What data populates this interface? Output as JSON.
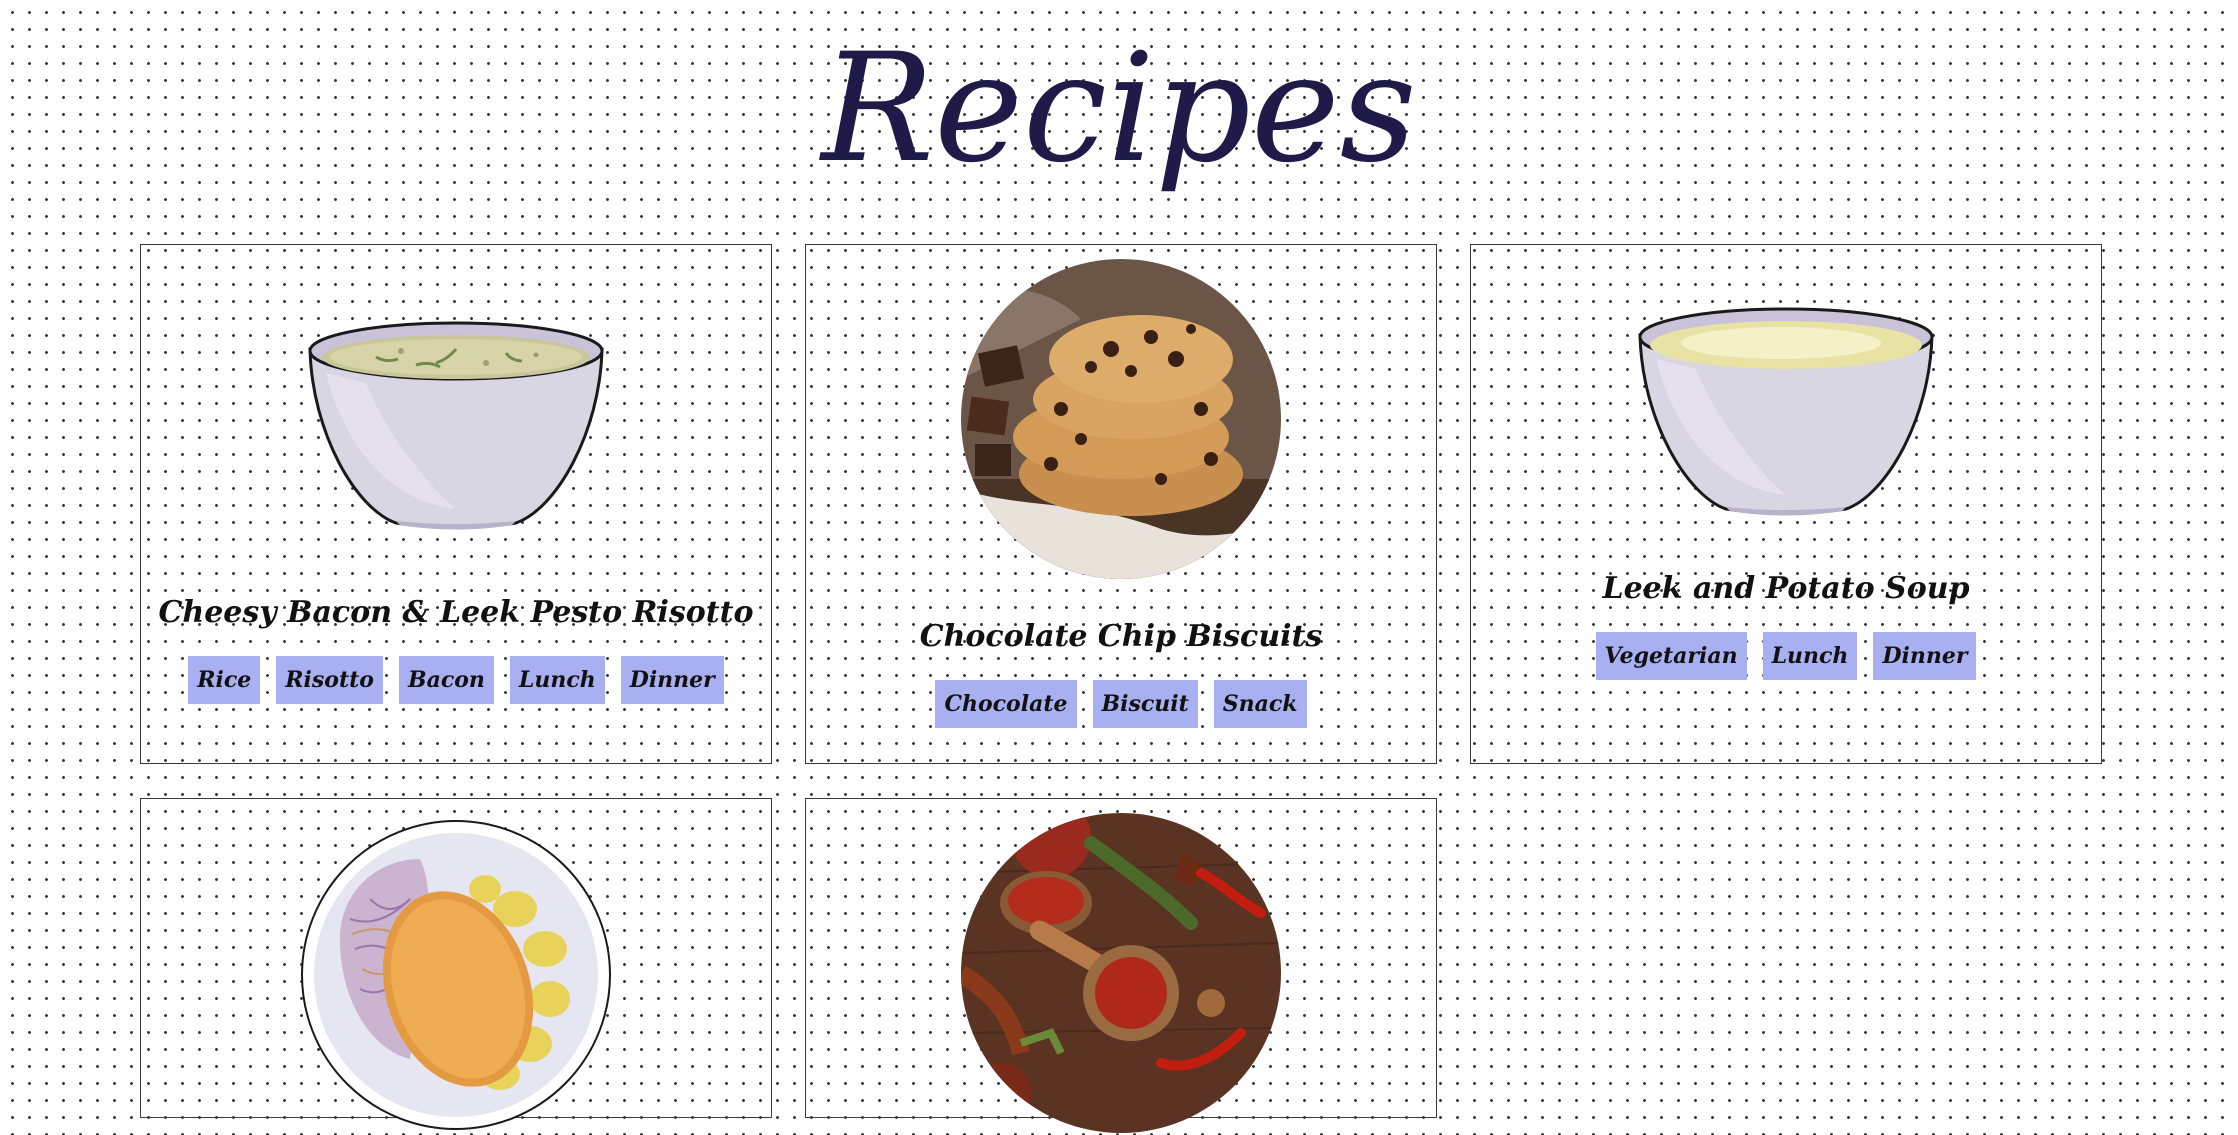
{
  "page": {
    "title": "Recipes"
  },
  "colors": {
    "title": "#1f1a47",
    "tag_bg": "#a8b0f2",
    "card_border": "#3a3a3a"
  },
  "recipes": [
    {
      "title": "Cheesy Bacon & Leek Pesto Risotto",
      "tags": [
        "Rice",
        "Risotto",
        "Bacon",
        "Lunch",
        "Dinner"
      ],
      "image": "risotto-bowl"
    },
    {
      "title": "Chocolate Chip Biscuits",
      "tags": [
        "Chocolate",
        "Biscuit",
        "Snack"
      ],
      "image": "cookies-stack"
    },
    {
      "title": "Leek and Potato Soup",
      "tags": [
        "Vegetarian",
        "Lunch",
        "Dinner"
      ],
      "image": "soup-bowl"
    },
    {
      "title": "",
      "tags": [],
      "image": "plate-fritter-coleslaw"
    },
    {
      "title": "",
      "tags": [],
      "image": "spices-board"
    }
  ]
}
